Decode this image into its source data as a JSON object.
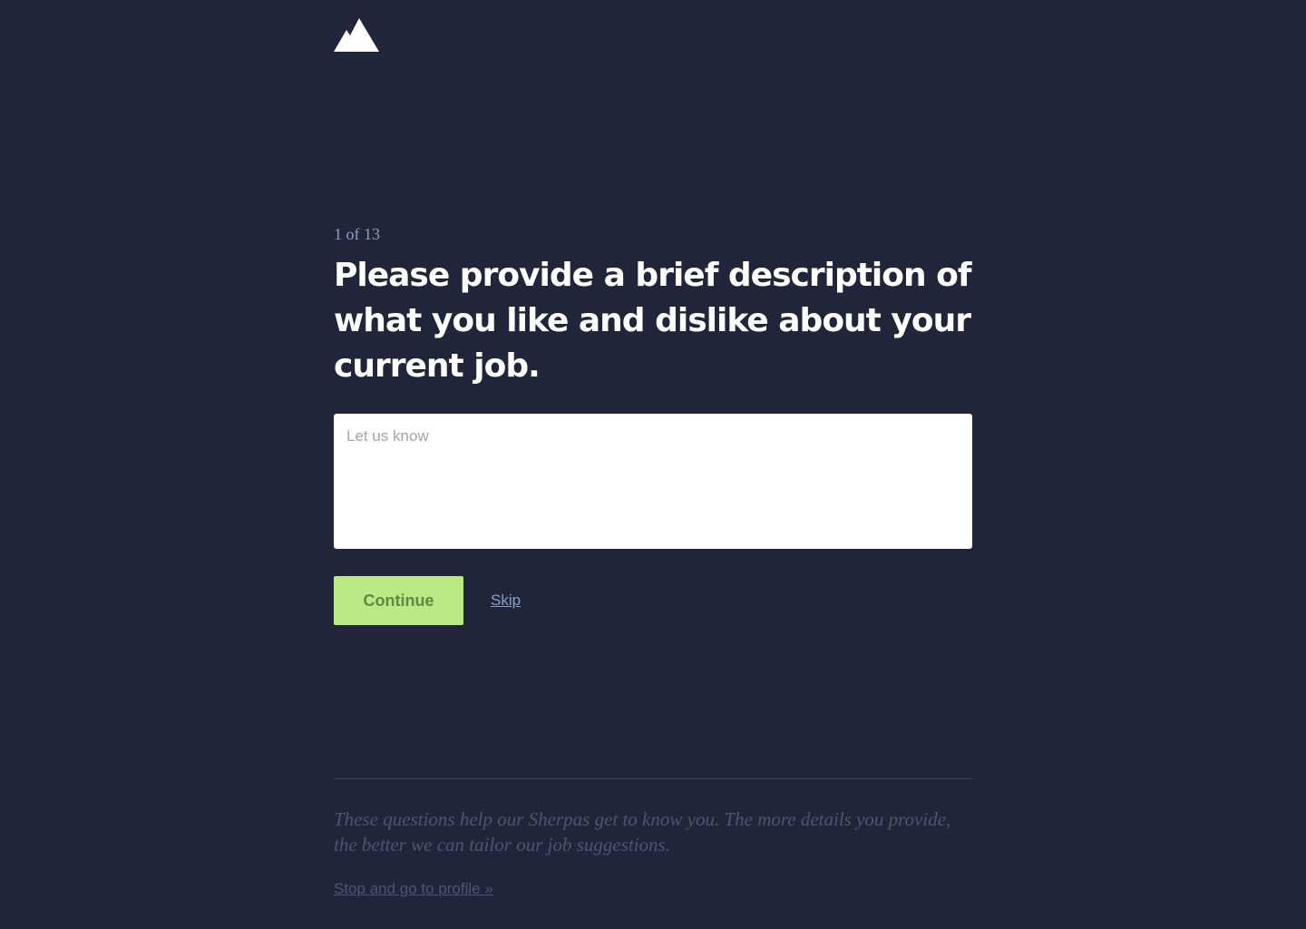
{
  "brand": {
    "logo_icon": "mountain-icon",
    "logo_color": "#ffffff"
  },
  "colors": {
    "background": "#20253a",
    "accent": "#bce886",
    "accent_text": "#5d8a45",
    "muted": "#8aa0c4"
  },
  "question": {
    "progress": "1 of 13",
    "title": "Please provide a brief description of what you like and dislike about your current job.",
    "answer_value": "",
    "answer_placeholder": "Let us know"
  },
  "actions": {
    "continue_label": "Continue",
    "skip_label": "Skip"
  },
  "footer": {
    "note": "These questions help our Sherpas get to know you. The more details you provide, the better we can tailor our job suggestions.",
    "profile_link": "Stop and go to profile »"
  }
}
